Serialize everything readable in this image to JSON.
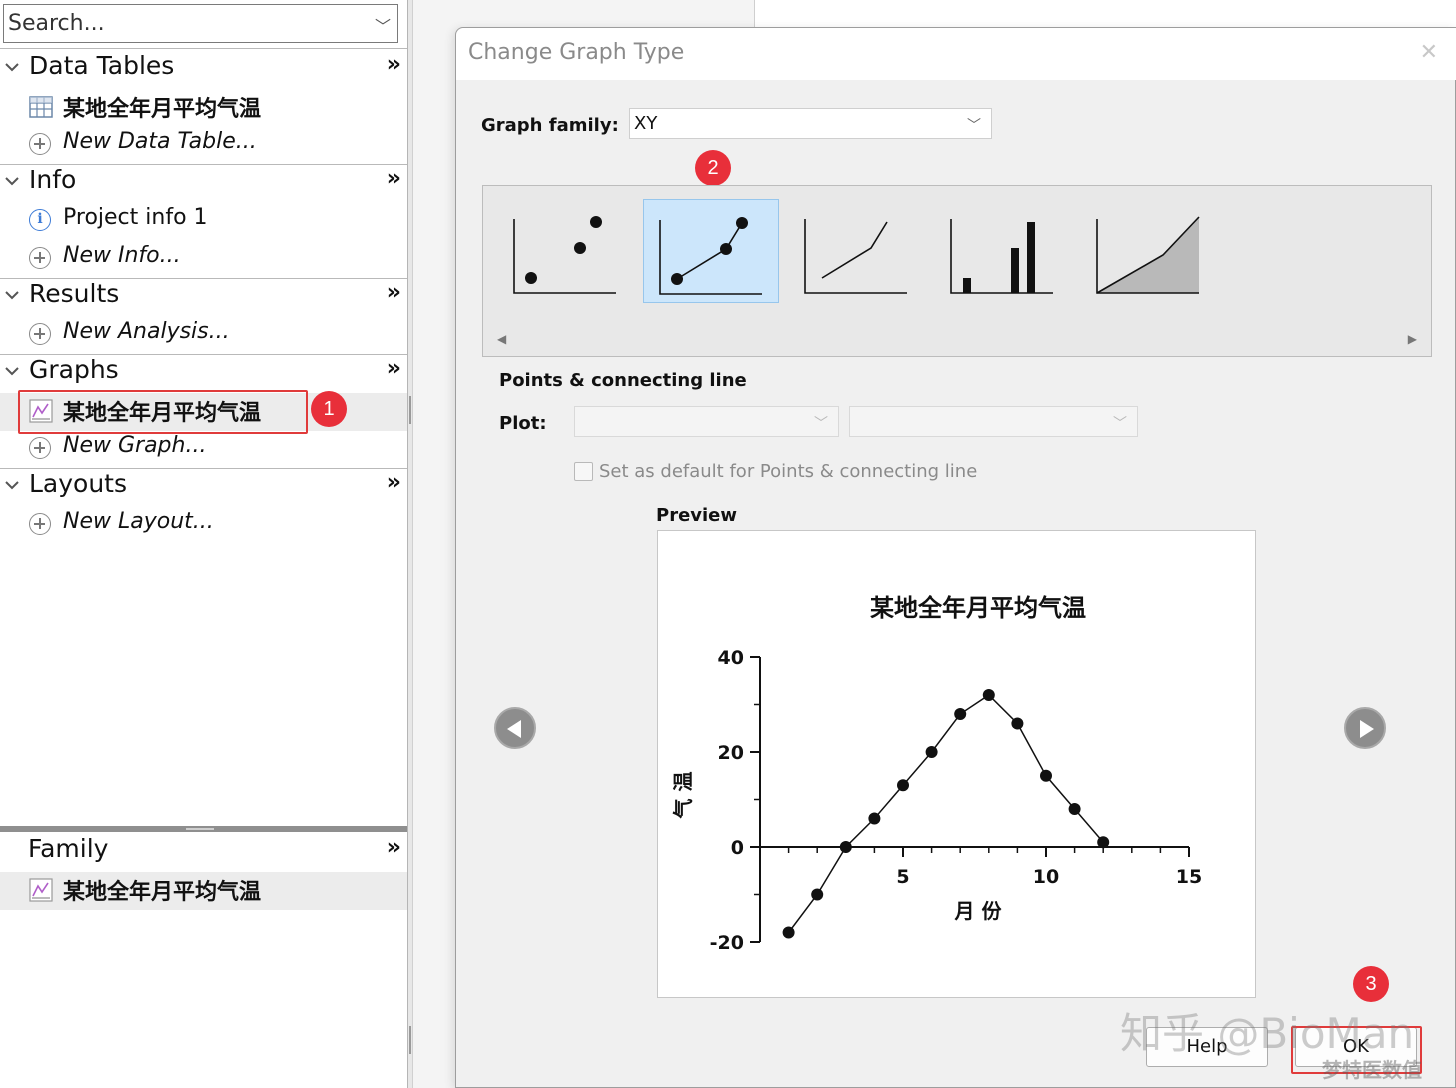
{
  "navigator": {
    "search_placeholder": "Search...",
    "more_glyph": "»",
    "sections": {
      "data_tables": {
        "title": "Data Tables",
        "items": [
          "某地全年月平均气温",
          "New Data Table..."
        ]
      },
      "info": {
        "title": "Info",
        "items": [
          "Project info 1",
          "New Info..."
        ]
      },
      "results": {
        "title": "Results",
        "items": [
          "New Analysis..."
        ]
      },
      "graphs": {
        "title": "Graphs",
        "items": [
          "某地全年月平均气温",
          "New Graph..."
        ]
      },
      "layouts": {
        "title": "Layouts",
        "items": [
          "New Layout..."
        ]
      }
    },
    "family": {
      "title": "Family",
      "items": [
        "某地全年月平均气温"
      ]
    },
    "icons": [
      "table-icon",
      "plus-circle-icon",
      "info-icon",
      "graph-icon",
      "chevron-down-icon"
    ]
  },
  "annotations": {
    "badge1": "1",
    "badge2": "2",
    "badge3": "3"
  },
  "dialog": {
    "title": "Change Graph Type",
    "close_glyph": "✕",
    "graph_family_label": "Graph family:",
    "graph_family_value": "XY",
    "graph_types": [
      "points-only",
      "points-and-connecting-line",
      "connecting-line-only",
      "spikes",
      "area-fill"
    ],
    "selected_type_name": "Points & connecting line",
    "plot_label": "Plot:",
    "default_checkbox_label": "Set as default for Points & connecting line",
    "preview_label": "Preview",
    "help_button": "Help",
    "ok_button": "OK",
    "accent_color": "#cce6fb",
    "annotation_color": "#e82f3a"
  },
  "chart_data": {
    "type": "line",
    "title": "某地全年月平均气温",
    "xlabel": "月 份",
    "ylabel": "气 温",
    "x": [
      1,
      2,
      3,
      4,
      5,
      6,
      7,
      8,
      9,
      10,
      11,
      12
    ],
    "y": [
      -18,
      -10,
      0,
      6,
      13,
      20,
      28,
      32,
      26,
      15,
      8,
      1
    ],
    "xlim": [
      0,
      15
    ],
    "ylim": [
      -20,
      40
    ],
    "xticks": [
      "5",
      "10",
      "15"
    ],
    "yticks": [
      "-20",
      "0",
      "20",
      "40"
    ],
    "markers": "filled-circle",
    "grid": false
  },
  "watermark": {
    "main": "知乎 @BioMan",
    "sub": "梦特医数值"
  }
}
